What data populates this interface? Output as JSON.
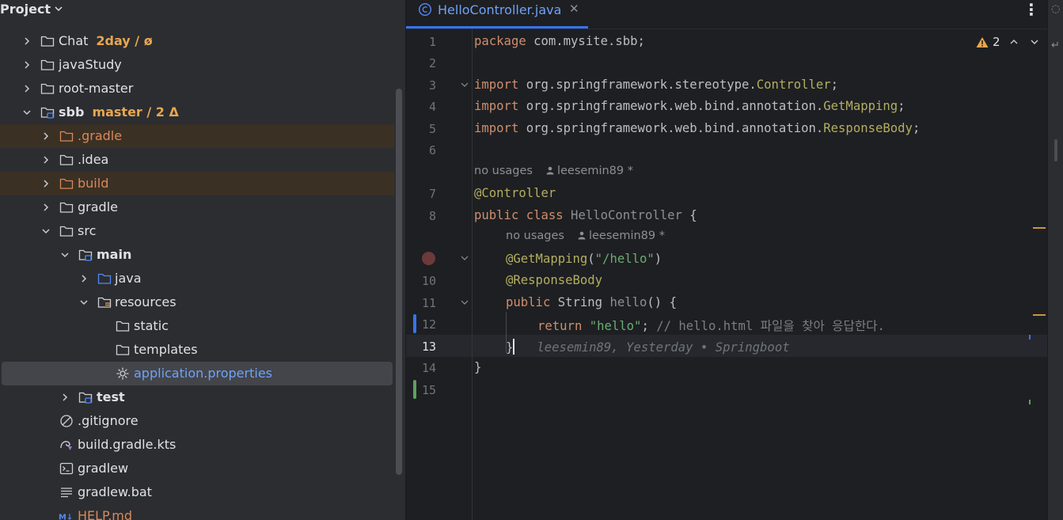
{
  "project_panel": {
    "title": "Project",
    "tree": [
      {
        "label": "Chat",
        "vcs": "2day / ø"
      },
      {
        "label": "javaStudy"
      },
      {
        "label": "root-master"
      },
      {
        "label": "sbb",
        "vcs": "master / 2 Δ"
      },
      {
        "label": ".gradle"
      },
      {
        "label": ".idea"
      },
      {
        "label": "build"
      },
      {
        "label": "gradle"
      },
      {
        "label": "src"
      },
      {
        "label": "main"
      },
      {
        "label": "java"
      },
      {
        "label": "resources"
      },
      {
        "label": "static"
      },
      {
        "label": "templates"
      },
      {
        "label": "application.properties"
      },
      {
        "label": "test"
      },
      {
        "label": ".gitignore"
      },
      {
        "label": "build.gradle.kts"
      },
      {
        "label": "gradlew"
      },
      {
        "label": "gradlew.bat"
      },
      {
        "label": "HELP.md"
      }
    ]
  },
  "editor": {
    "tab": {
      "label": "HelloController.java"
    },
    "warnings": {
      "count": "2"
    },
    "line_numbers": [
      "1",
      "2",
      "3",
      "4",
      "5",
      "6",
      "7",
      "8",
      "9",
      "10",
      "11",
      "12",
      "13",
      "14",
      "15"
    ],
    "current_line": "13",
    "code": {
      "l1_kw": "package",
      "l1_rest": " com.mysite.sbb;",
      "l3_kw": "import",
      "l3_pkg": " org.springframework.stereotype.",
      "l3_cls": "Controller",
      "l3_end": ";",
      "l4_kw": "import",
      "l4_pkg": " org.springframework.web.bind.annotation.",
      "l4_cls": "GetMapping",
      "l4_end": ";",
      "l5_kw": "import",
      "l5_pkg": " org.springframework.web.bind.annotation.",
      "l5_cls": "ResponseBody",
      "l5_end": ";",
      "l7_ann": "@Controller",
      "l8_kw": "public class",
      "l8_name": " HelloController",
      "l8_end": " {",
      "l9_ann": "@GetMapping",
      "l9_open": "(",
      "l9_str": "\"/hello\"",
      "l9_close": ")",
      "l10_ann": "@ResponseBody",
      "l11_kw": "public",
      "l11_type": " String ",
      "l11_name": "hello",
      "l11_end": "() {",
      "l12_kw": "return",
      "l12_str": " \"hello\"",
      "l12_semi": ";",
      "l12_cmt": " // hello.html 파일을 찾아 응답한다.",
      "l13_brace": "}",
      "l14_brace": "}"
    },
    "inlay_hints": {
      "class_usages": "no usages",
      "class_author": "leesemin89 *",
      "method_usages": "no usages",
      "method_author": "leesemin89 *"
    },
    "blame": "leesemin89, Yesterday • Springboot"
  }
}
